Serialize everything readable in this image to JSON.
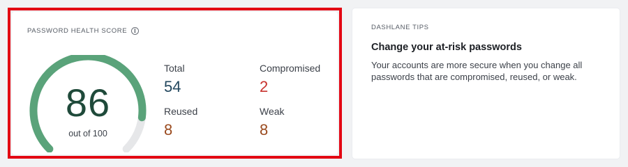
{
  "score_card": {
    "label": "PASSWORD HEALTH SCORE",
    "info_icon": "info-icon",
    "score": "86",
    "score_caption": "out of 100",
    "score_fraction": 0.86,
    "gauge_color": "#5aa37a",
    "gauge_track_color": "#e6e7e9",
    "stats": {
      "total": {
        "label": "Total",
        "value": "54",
        "color": "#22475e"
      },
      "compromised": {
        "label": "Compromised",
        "value": "2",
        "color": "#c8332e"
      },
      "reused": {
        "label": "Reused",
        "value": "8",
        "color": "#9a4a1e"
      },
      "weak": {
        "label": "Weak",
        "value": "8",
        "color": "#9a4a1e"
      }
    }
  },
  "tips_card": {
    "label": "DASHLANE TIPS",
    "title": "Change your at-risk passwords",
    "body": "Your accounts are more secure when you change all passwords that are compromised, reused, or weak."
  },
  "highlight_color": "#e30613"
}
